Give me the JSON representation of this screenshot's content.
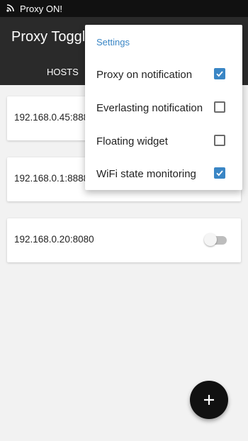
{
  "status_bar": {
    "text": "Proxy ON!",
    "icon": "wifi-icon"
  },
  "app_bar": {
    "title": "Proxy Toggle",
    "tabs": [
      {
        "label": "HOSTS"
      }
    ]
  },
  "hosts": [
    {
      "address": "192.168.0.45:8888",
      "enabled": true
    },
    {
      "address": "192.168.0.1:8888",
      "enabled": false
    },
    {
      "address": "192.168.0.20:8080",
      "enabled": false
    }
  ],
  "settings_menu": {
    "title": "Settings",
    "items": [
      {
        "label": "Proxy on notification",
        "checked": true
      },
      {
        "label": "Everlasting notification",
        "checked": false
      },
      {
        "label": "Floating widget",
        "checked": false
      },
      {
        "label": "WiFi state monitoring",
        "checked": true
      }
    ]
  },
  "fab": {
    "icon": "plus-icon"
  },
  "colors": {
    "accent": "#3a86c5",
    "app_bar": "#2a2a2a",
    "status_bar": "#111111",
    "background": "#f2f2f2",
    "fab": "#111111"
  }
}
